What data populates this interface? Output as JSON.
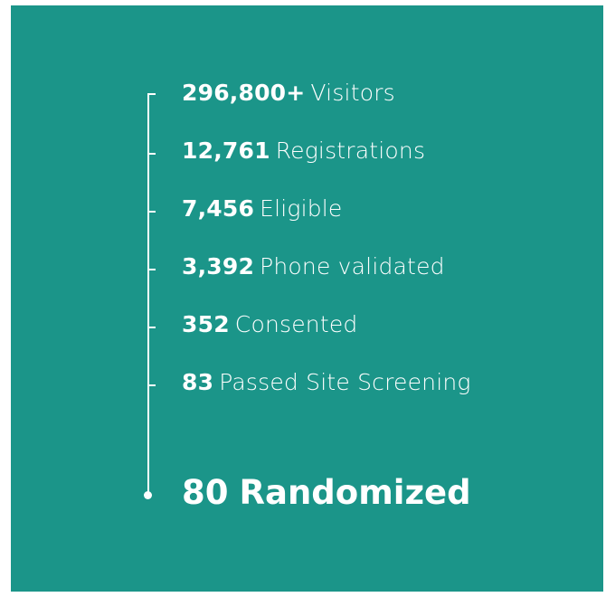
{
  "funnel": {
    "steps": [
      {
        "number": "296,800+",
        "label": "Visitors"
      },
      {
        "number": "12,761",
        "label": "Registrations"
      },
      {
        "number": "7,456",
        "label": "Eligible"
      },
      {
        "number": "3,392",
        "label": "Phone validated"
      },
      {
        "number": "352",
        "label": "Consented"
      },
      {
        "number": "83",
        "label": "Passed Site Screening"
      }
    ],
    "final": {
      "number": "80",
      "label": "Randomized"
    }
  },
  "colors": {
    "background": "#1b9589",
    "text": "#ffffff"
  }
}
